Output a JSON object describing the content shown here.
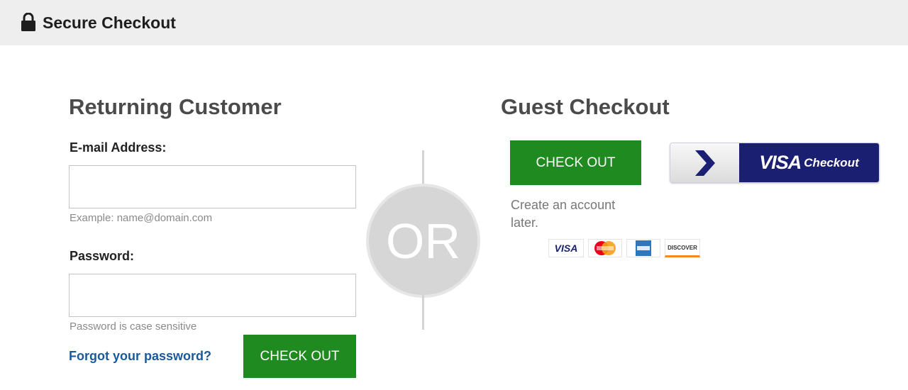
{
  "header": {
    "title": "Secure Checkout"
  },
  "returning_customer": {
    "title": "Returning Customer",
    "email_label": "E-mail Address:",
    "email_value": "",
    "email_hint": "Example: name@domain.com",
    "password_label": "Password:",
    "password_value": "",
    "password_hint": "Password is case sensitive",
    "forgot_link": "Forgot your password?",
    "checkout_button": "CHECK OUT"
  },
  "divider": {
    "label": "OR"
  },
  "guest_checkout": {
    "title": "Guest Checkout",
    "checkout_button": "CHECK OUT",
    "visa_checkout": {
      "brand": "VISA",
      "label": "Checkout"
    },
    "note": "Create an account later.",
    "accepted_cards": [
      {
        "name": "visa",
        "label": "VISA"
      },
      {
        "name": "mastercard",
        "label": "MasterCard"
      },
      {
        "name": "american-express",
        "label": "American Express"
      },
      {
        "name": "discover",
        "label": "DISCOVER"
      }
    ]
  },
  "colors": {
    "header_bg": "#eeeeee",
    "button_green": "#1f8a1f",
    "link_blue": "#1a5a9b",
    "visa_navy": "#1a1f71",
    "divider_gray": "#d6d6d6"
  }
}
